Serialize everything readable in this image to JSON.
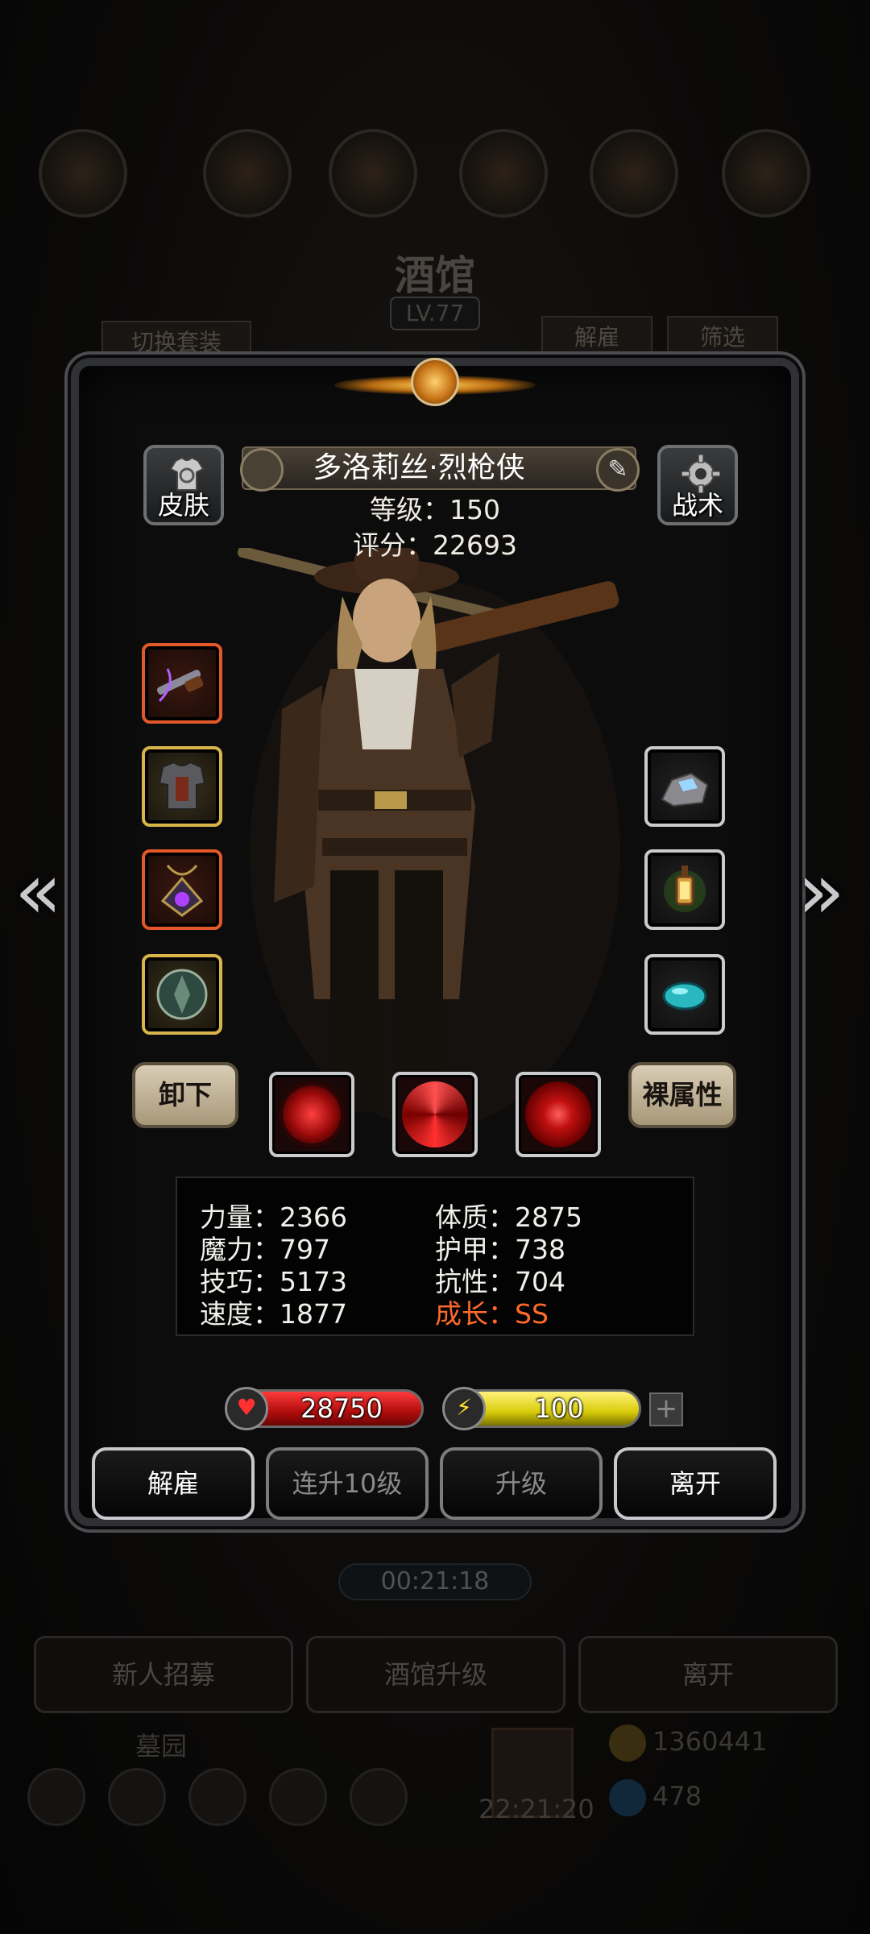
{
  "background": {
    "title": "酒馆",
    "level": "LV.77",
    "switch_outfit": "切换套装",
    "dismiss_tab": "解雇",
    "filter_tab": "筛选",
    "timer": "00:21:18",
    "buttons": [
      "新人招募",
      "酒馆升级",
      "离开"
    ],
    "cemetery": "墓园",
    "clock": "22:21:20",
    "gold": "1360441",
    "gems": "478"
  },
  "hero": {
    "skin_label": "皮肤",
    "tactics_label": "战术",
    "name": "多洛莉丝·烈枪侠",
    "level": "等级：150",
    "score": "评分：22693",
    "unequip_label": "卸下",
    "bare_attr_label": "裸属性"
  },
  "stats": {
    "strength": "力量：2366",
    "magic": "魔力：797",
    "skill": "技巧：5173",
    "speed": "速度：1877",
    "constitution": "体质：2875",
    "armor": "护甲：738",
    "resistance": "抗性：704",
    "growth": "成长：SS"
  },
  "bars": {
    "hp": "28750",
    "energy": "100"
  },
  "actions": {
    "dismiss": "解雇",
    "level_up_10": "连升10级",
    "level_up": "升级",
    "leave": "离开"
  },
  "colors": {
    "growth": "#ff6a2a",
    "hp_bar": "#d01a1a",
    "energy_bar": "#e4d81a",
    "slot_red": "#e3582a",
    "slot_gold": "#d8b54a"
  },
  "icons": {
    "skin": "shirt-refresh-icon",
    "tactics": "gear-icon",
    "edit": "pencil-icon",
    "hp": "heart-icon",
    "energy": "lightning-icon"
  }
}
